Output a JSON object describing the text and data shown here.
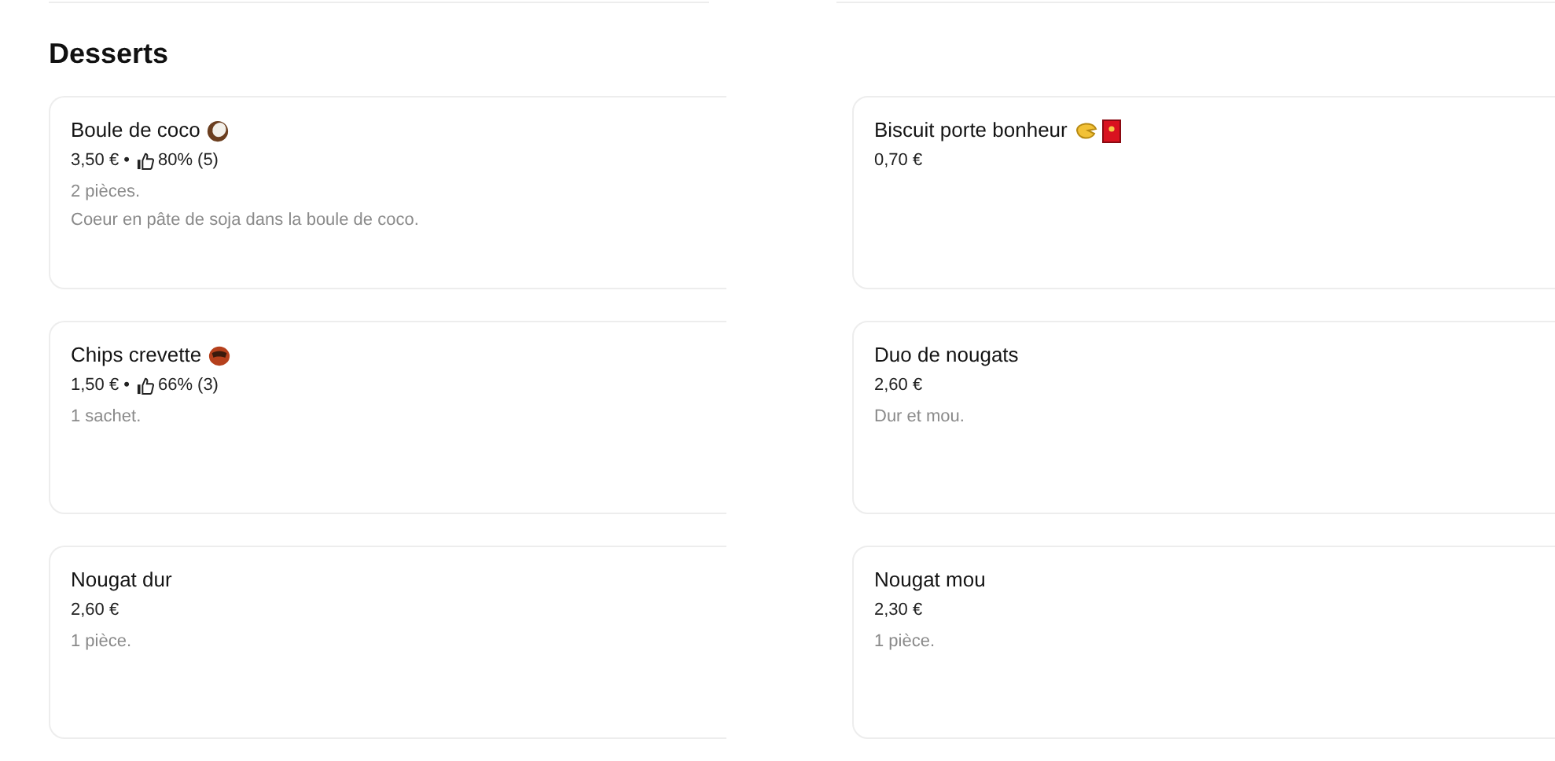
{
  "section": {
    "title": "Desserts"
  },
  "items": [
    {
      "name": "Boule de coco",
      "icons": [
        {
          "kind": "coconut"
        }
      ],
      "price": "3,50 €",
      "separator": "•",
      "rating": "80% (5)",
      "description": [
        "2 pièces.",
        "Coeur en pâte de soja dans la boule de coco."
      ]
    },
    {
      "name": "Biscuit porte bonheur",
      "icons": [
        {
          "kind": "cookie"
        },
        {
          "kind": "envelope"
        }
      ],
      "price": "0,70 €"
    },
    {
      "name": "Chips crevette",
      "icons": [
        {
          "kind": "chip"
        }
      ],
      "price": "1,50 €",
      "separator": "•",
      "rating": "66% (3)",
      "description": [
        "1 sachet."
      ]
    },
    {
      "name": "Duo de nougats",
      "price": "2,60 €",
      "description": [
        "Dur et mou."
      ]
    },
    {
      "name": "Nougat dur",
      "price": "2,60 €",
      "description": [
        "1 pièce."
      ]
    },
    {
      "name": "Nougat mou",
      "price": "2,30 €",
      "description": [
        "1 pièce."
      ]
    }
  ]
}
